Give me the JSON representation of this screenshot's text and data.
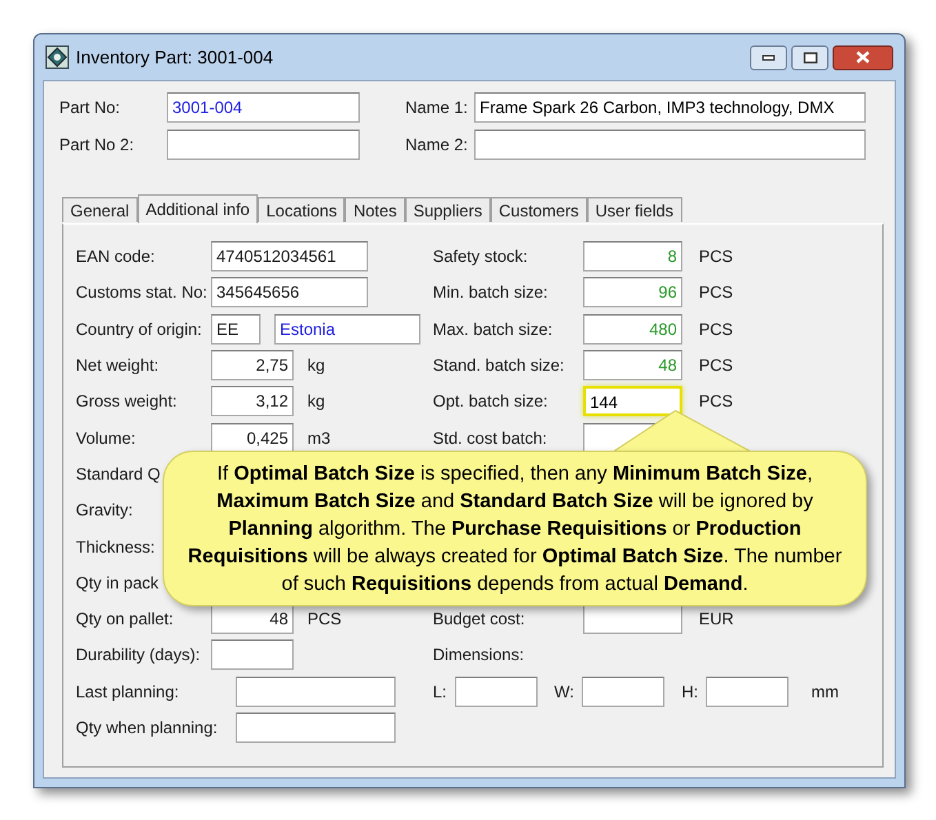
{
  "window": {
    "title": "Inventory Part: 3001-004"
  },
  "header_fields": [
    {
      "label": "Part No:",
      "value": "3001-004",
      "kind": "lookup"
    },
    {
      "label": "Name 1:",
      "value": "Frame Spark 26 Carbon, IMP3 technology, DMX",
      "kind": "text"
    },
    {
      "label": "Part No 2:",
      "kind": "text"
    },
    {
      "label": "Name 2:",
      "kind": "text"
    }
  ],
  "tabs": [
    {
      "label": "General",
      "selected": false
    },
    {
      "label": "Additional info",
      "selected": true
    },
    {
      "label": "Locations",
      "selected": false
    },
    {
      "label": "Notes",
      "selected": false
    },
    {
      "label": "Suppliers",
      "selected": false
    },
    {
      "label": "Customers",
      "selected": false
    },
    {
      "label": "User fields",
      "selected": false
    }
  ],
  "left_fields": [
    {
      "label": "EAN code:",
      "value": "4740512034561",
      "kind": "text"
    },
    {
      "label": "Customs stat. No:",
      "value": "345645656",
      "kind": "text"
    },
    {
      "label": "Country of origin:",
      "value": "EE",
      "name": "Estonia",
      "kind": "country"
    },
    {
      "label": "Net weight:",
      "value": "2,75",
      "unit": "kg",
      "kind": "number"
    },
    {
      "label": "Gross weight:",
      "value": "3,12",
      "unit": "kg",
      "kind": "number"
    },
    {
      "label": "Volume:",
      "value": "0,425",
      "unit": "m3",
      "kind": "number"
    },
    {
      "label": "Standard Q",
      "kind": "label"
    },
    {
      "label": "Gravity:",
      "kind": "label"
    },
    {
      "label": "Thickness:",
      "kind": "label"
    },
    {
      "label": "Qty in pack",
      "kind": "label"
    },
    {
      "label": "Qty on pallet:",
      "value": "48",
      "unit": "PCS",
      "kind": "number"
    },
    {
      "label": "Durability (days):",
      "kind": "number"
    }
  ],
  "planning_fields": [
    {
      "label": "Last planning:"
    },
    {
      "label": "Qty when planning:"
    }
  ],
  "right_fields": [
    {
      "label": "Safety stock:",
      "value": "8",
      "unit": "PCS",
      "focused": false
    },
    {
      "label": "Min. batch size:",
      "value": "96",
      "unit": "PCS",
      "focused": false
    },
    {
      "label": "Max. batch size:",
      "value": "480",
      "unit": "PCS",
      "focused": false
    },
    {
      "label": "Stand. batch size:",
      "value": "48",
      "unit": "PCS",
      "focused": false
    },
    {
      "label": "Opt. batch size:",
      "value": "144",
      "unit": "PCS",
      "focused": true
    },
    {
      "label": "Std. cost batch:",
      "focused": false
    }
  ],
  "budget": {
    "label": "Budget cost:",
    "unit": "EUR"
  },
  "dimensions": {
    "label": "Dimensions:",
    "parts": [
      {
        "label": "L:"
      },
      {
        "label": "W:"
      },
      {
        "label": "H:"
      }
    ],
    "unit": "mm"
  },
  "callout": {
    "text": "If **Optimal Batch Size** is specified, then any **Minimum Batch Size**, **Maximum Batch Size** and **Standard Batch Size** will be ignored by **Planning** algorithm.  The **Purchase Requisitions** or **Production Requisitions** will be always created for **Optimal Batch Size**.  The number of such **Requisitions** depends from actual **Demand**."
  }
}
